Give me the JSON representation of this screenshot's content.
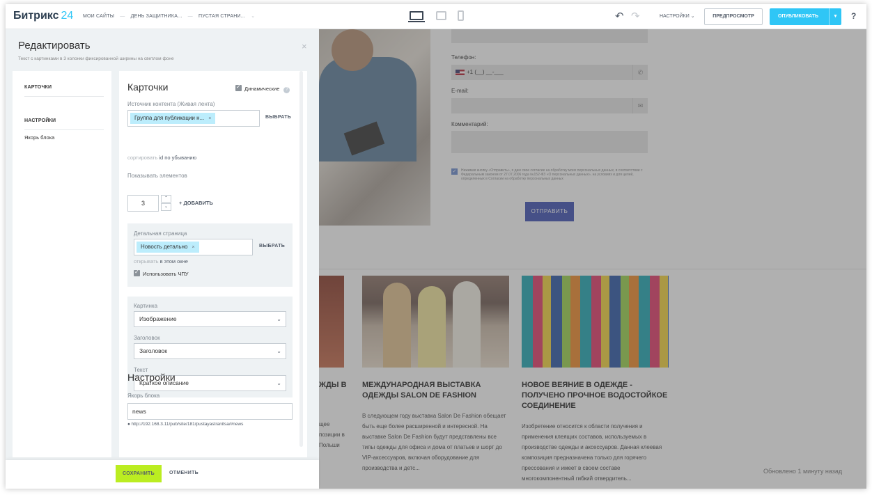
{
  "topbar": {
    "logo_text": "Битрикс",
    "logo_num": "24",
    "crumbs": [
      "МОИ САЙТЫ",
      "ДЕНЬ ЗАЩИТНИКА...",
      "ПУСТАЯ СТРАНИ..."
    ],
    "crumb_sep": "—",
    "crumb_caret": "⌄",
    "settings_label": "НАСТРОЙКИ",
    "preview_label": "ПРЕДПРОСМОТР",
    "publish_label": "ОПУБЛИКОВАТЬ",
    "help_label": "?",
    "accent_color": "#2fc6f6"
  },
  "panel": {
    "title": "Редактировать",
    "subtitle": "Текст с картинками в 3 колонки фиксированной ширины на светлом фоне",
    "close_label": "×",
    "sidebar": {
      "items": [
        "КАРТОЧКИ",
        "НАСТРОЙКИ",
        "Якорь блока"
      ]
    },
    "cards_heading": "Карточки",
    "dynamic_label": "Динамические",
    "source_label": "Источник контента (Живая лента)",
    "source_tag": "Группа для публикации н...",
    "select_label": "ВЫБРАТЬ",
    "sort_prefix": "сортировать",
    "sort_field": "id",
    "sort_order": "по убыванию",
    "show_label": "Показывать элементов",
    "show_count": "3",
    "add_label": "+ ДОБАВИТЬ",
    "detail_label": "Детальная страница",
    "detail_tag": "Новость детально",
    "open_prefix": "открывать",
    "open_value": "в этом окне",
    "chpu_label": "Использовать ЧПУ",
    "picture_label": "Картинка",
    "picture_value": "Изображение",
    "heading_label": "Заголовок",
    "heading_value": "Заголовок",
    "text_label": "Текст",
    "text_value": "Краткое описание",
    "settings_heading": "Настройки",
    "anchor_label": "Якорь блока",
    "anchor_value": "news",
    "anchor_url": "http://192.168.3.11/pub/site/181/pustayastranitsa/#news",
    "save_label": "СОХРАНИТЬ",
    "cancel_label": "ОТМЕНИТЬ"
  },
  "page": {
    "phone_label": "Телефон:",
    "phone_value": "+1 (__) __-___",
    "email_label": "E-mail:",
    "comment_label": "Комментарий:",
    "consent_text": "Нажимая кнопку «Отправить», я даю свое согласие на обработку моих персональных данных, в соответствии с Федеральным законом от 27.07.2006 года №152-ФЗ «О персональных данных», на условиях и для целей, определенных в Согласии на обработку персональных данных",
    "send_label": "ОТПРАВИТЬ",
    "partial_heading": "ЖДЫ В",
    "partial_text": "щее позиции в Польши",
    "cards": [
      {
        "title": "МЕЖДУНАРОДНАЯ ВЫСТАВКА ОДЕЖДЫ SALON DE FASHION",
        "text": "В следующем году выставка Salon De Fashion обещает быть еще более расширенной и интересной. На выставке Salon De Fashion будут представлены все типы одежды для офиса и дома от платьев и шорт до VIP-аксессуаров, включая оборудование для производства и детс..."
      },
      {
        "title": "НОВОЕ ВЕЯНИЕ В ОДЕЖДЕ - ПОЛУЧЕНО ПРОЧНОЕ ВОДОСТОЙКОЕ СОЕДИНЕНИЕ",
        "text": "Изобретение относится к области получения и применения клеящих составов, используемых в производстве одежды и аксессуаров. Данная клеевая композиция предназначена только для горячего прессования и имеет в своем составе многокомпонентный гибкий отвердитель..."
      }
    ],
    "updated": "Обновлено 1 минуту назад"
  }
}
